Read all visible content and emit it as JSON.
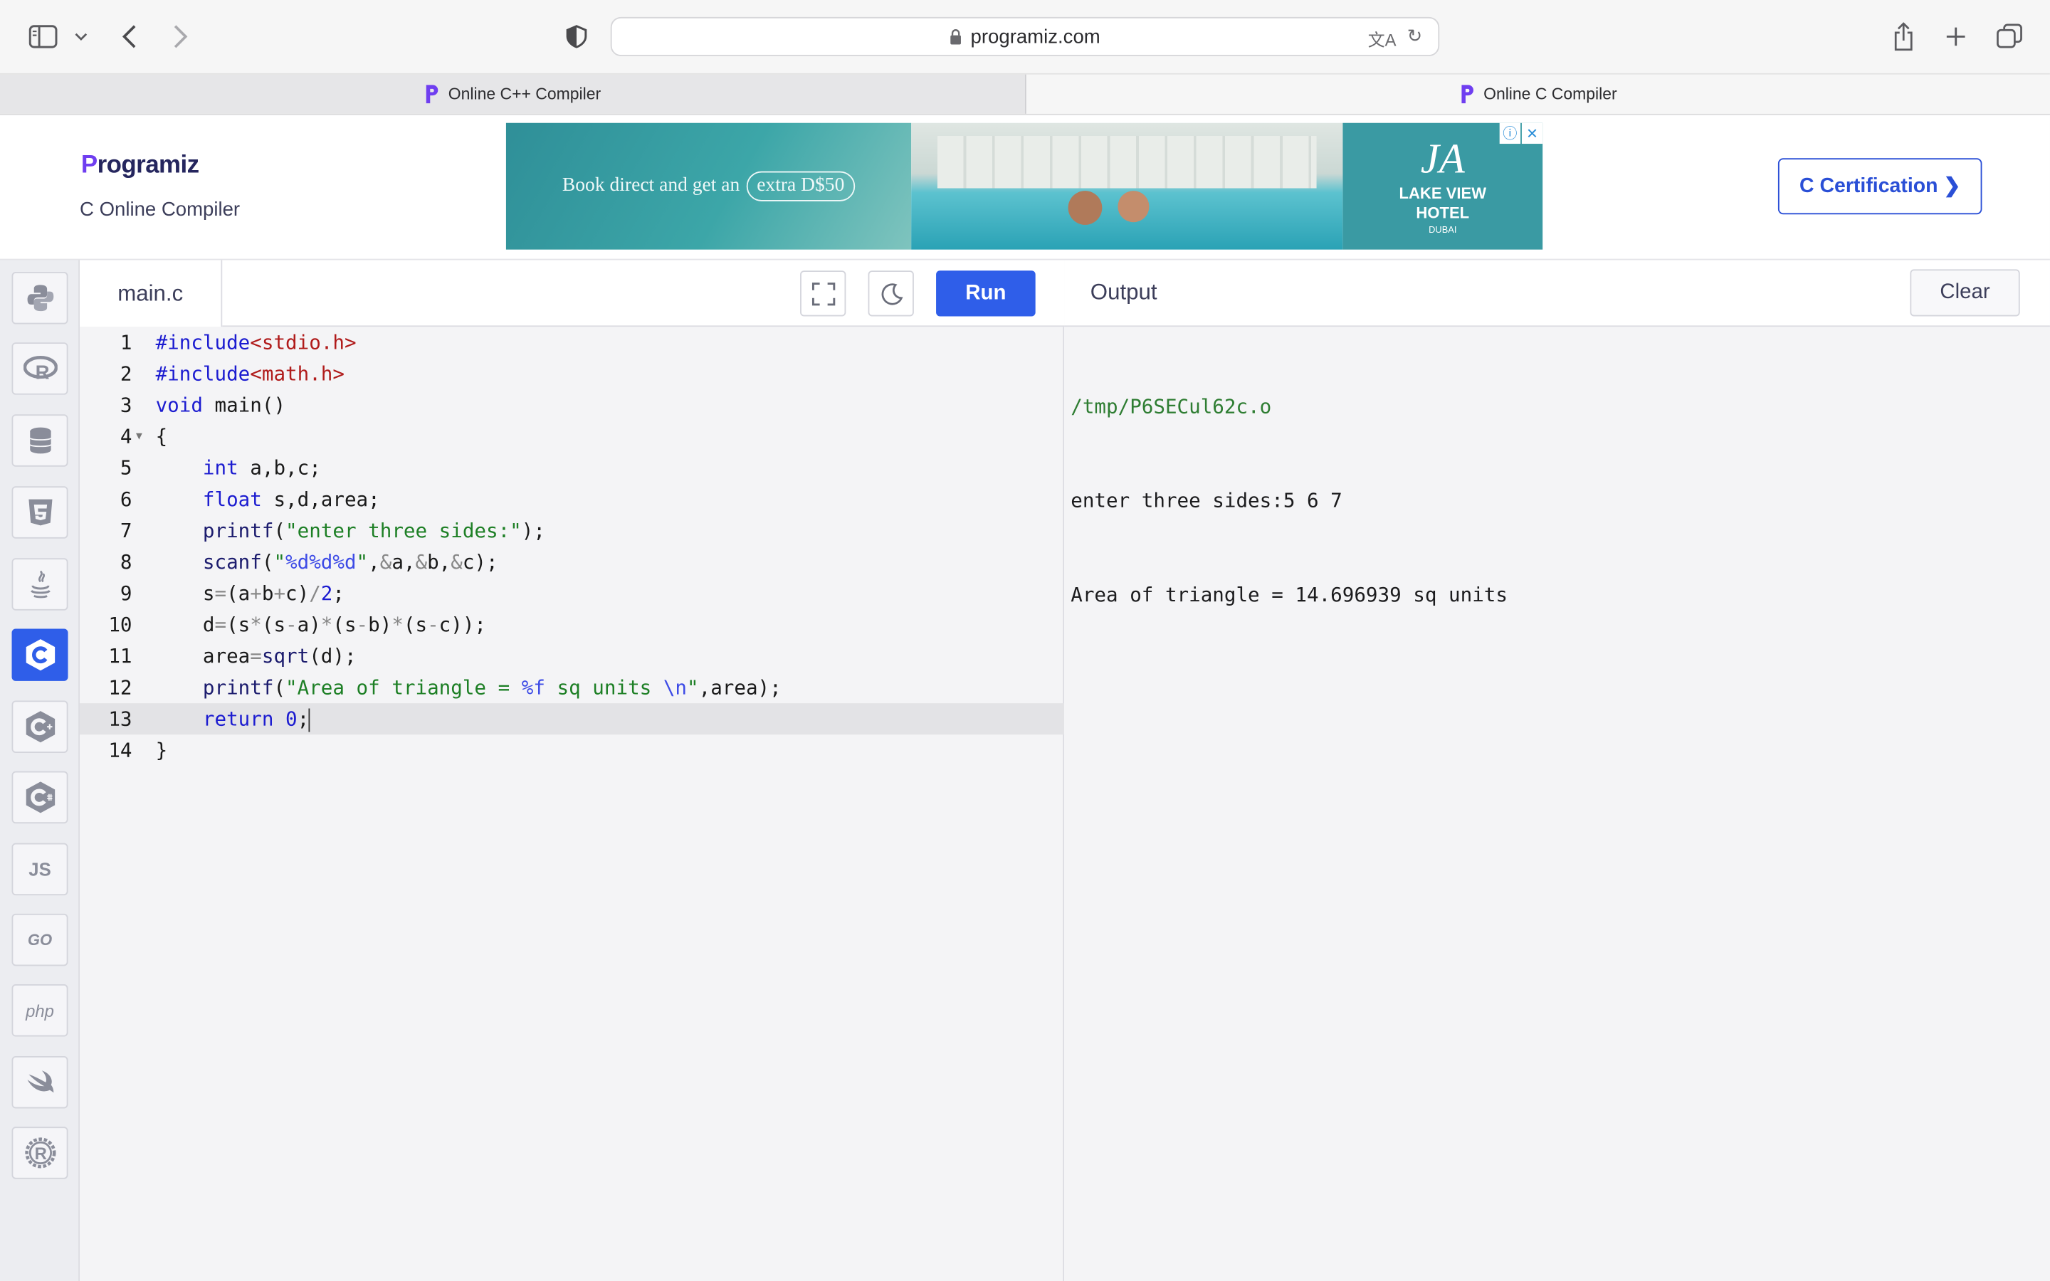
{
  "browser": {
    "url": "programiz.com",
    "tabs": [
      {
        "title": "Online C++ Compiler",
        "active": false
      },
      {
        "title": "Online C Compiler",
        "active": true
      }
    ]
  },
  "header": {
    "brand": "rogramiz",
    "brand_initial": "P",
    "subtitle": "C Online Compiler",
    "certification_button": "C Certification ❯"
  },
  "ad": {
    "tagline_prefix": "Book direct and get an",
    "tagline_offer": "extra D$50",
    "logo_mark": "JA",
    "hotel_name_1": "LAKE VIEW",
    "hotel_name_2": "HOTEL",
    "hotel_city": "DUBAI",
    "info_glyph": "ⓘ",
    "close_glyph": "✕"
  },
  "sidebar": {
    "languages": [
      {
        "name": "python",
        "glyph": "",
        "active": false
      },
      {
        "name": "r",
        "glyph": "R",
        "active": false
      },
      {
        "name": "sql",
        "glyph": "",
        "active": false
      },
      {
        "name": "html",
        "glyph": "5",
        "active": false
      },
      {
        "name": "java",
        "glyph": "",
        "active": false
      },
      {
        "name": "c",
        "glyph": "C",
        "active": true
      },
      {
        "name": "cpp",
        "glyph": "C",
        "active": false
      },
      {
        "name": "csharp",
        "glyph": "C",
        "active": false
      },
      {
        "name": "javascript",
        "glyph": "JS",
        "active": false
      },
      {
        "name": "go",
        "glyph": "GO",
        "active": false
      },
      {
        "name": "php",
        "glyph": "php",
        "active": false
      },
      {
        "name": "swift",
        "glyph": "",
        "active": false
      },
      {
        "name": "rust",
        "glyph": "R",
        "active": false
      }
    ]
  },
  "editor": {
    "filename": "main.c",
    "run_label": "Run",
    "current_line": 13,
    "line_numbers": [
      "1",
      "2",
      "3",
      "4",
      "5",
      "6",
      "7",
      "8",
      "9",
      "10",
      "11",
      "12",
      "13",
      "14"
    ]
  },
  "output": {
    "title": "Output",
    "clear_label": "Clear",
    "lines": [
      "/tmp/P6SECul62c.o",
      "enter three sides:5 6 7",
      "Area of triangle = 14.696939 sq units"
    ]
  },
  "colors": {
    "accent": "#2f5ee9",
    "brand_purple": "#6f3ef0"
  }
}
